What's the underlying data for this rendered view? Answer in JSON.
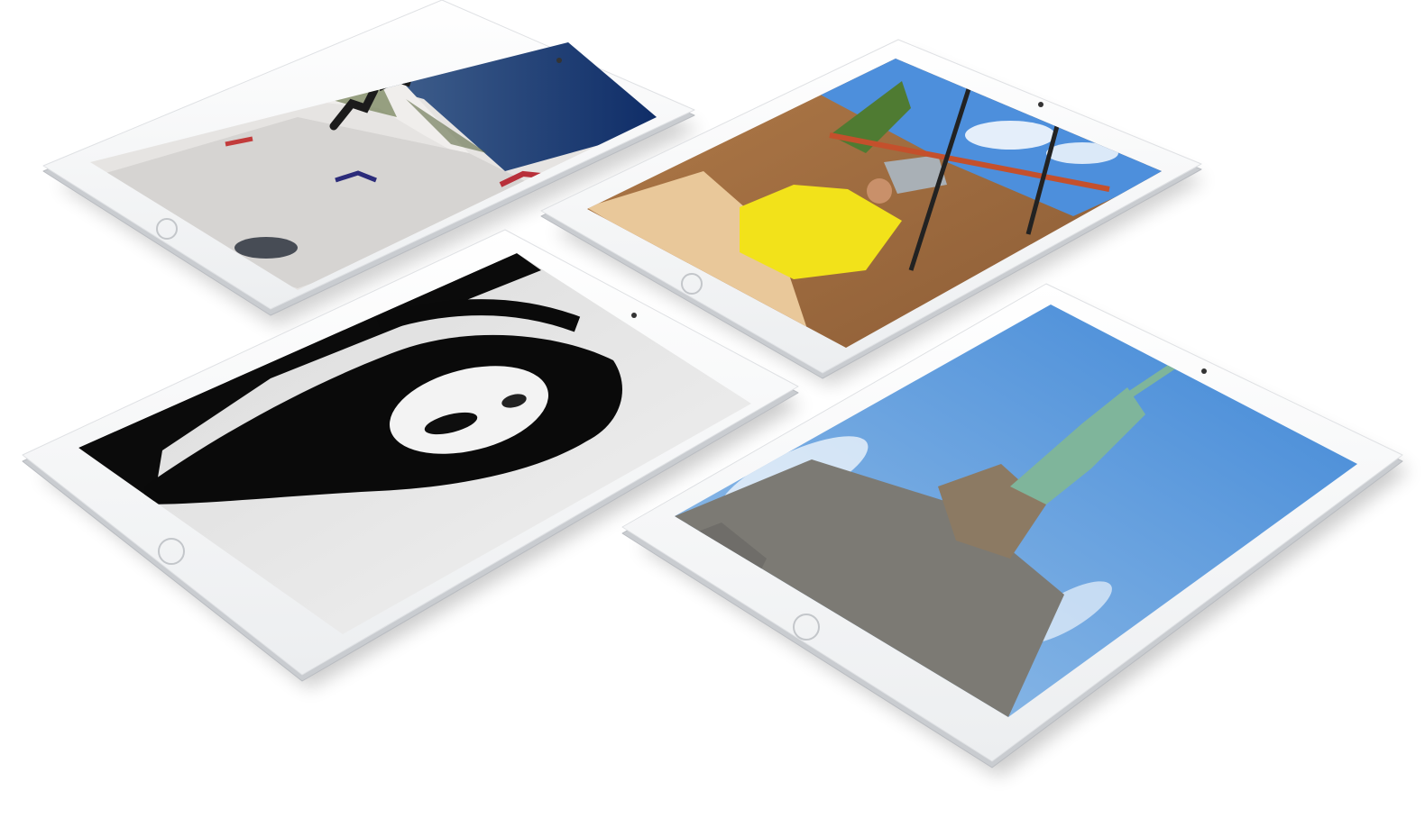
{
  "scene": {
    "background": "#ffffff",
    "bezel_color": "#f7f7f8",
    "edge_color": "#c9ccd0",
    "tablets": [
      {
        "screen_content": "skiers-on-snowy-mountain"
      },
      {
        "screen_content": "person-in-yellow-shirt-with-bucket"
      },
      {
        "screen_content": "black-and-white-woman-portrait"
      },
      {
        "screen_content": "statue-of-liberty-blue-sky"
      }
    ]
  }
}
